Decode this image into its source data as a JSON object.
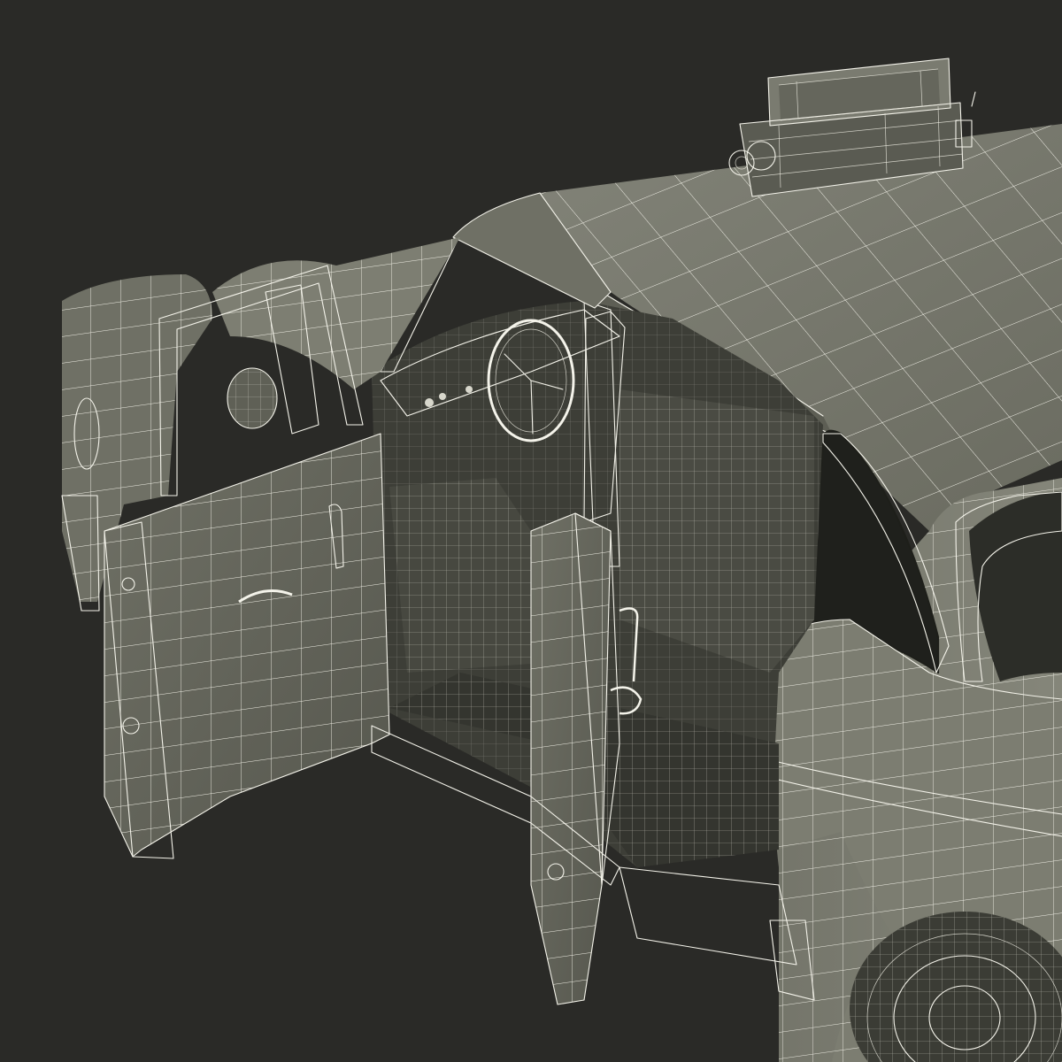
{
  "scene": {
    "subject": "taxi-car-wireframe-model",
    "background_color": "#2a2a27",
    "body_color": "#6d6e62",
    "body_light_color": "#7f8074",
    "body_shadow_color": "#4b4c43",
    "interior_color": "#3b3c35",
    "wire_color": "#f4f3ea"
  }
}
